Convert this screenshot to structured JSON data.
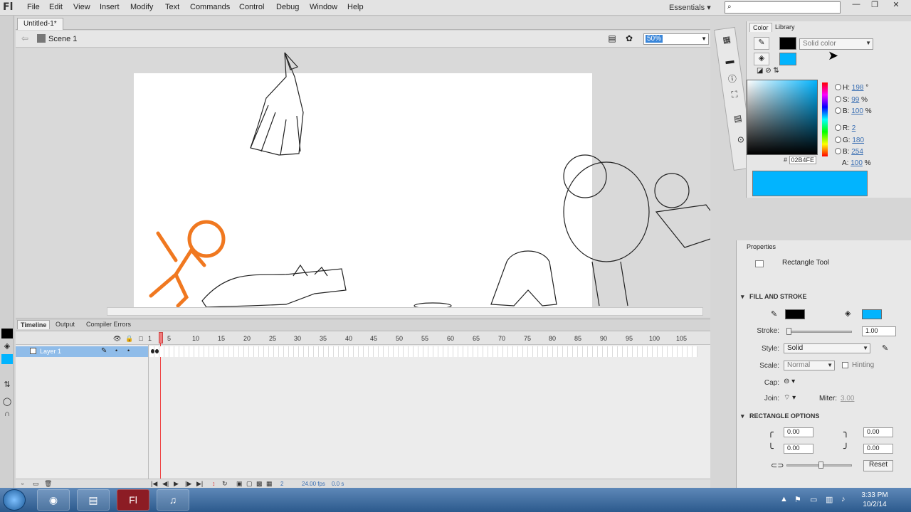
{
  "app": {
    "logo": "Fl"
  },
  "menu": [
    "File",
    "Edit",
    "View",
    "Insert",
    "Modify",
    "Text",
    "Commands",
    "Control",
    "Debug",
    "Window",
    "Help"
  ],
  "workspace": {
    "label": "Essentials",
    "arrow": "▾"
  },
  "window_controls": [
    "—",
    "❐",
    "✕"
  ],
  "document": {
    "tab": "Untitled-1*",
    "scene": "Scene 1",
    "zoom": "50%"
  },
  "timeline": {
    "tabs": [
      "Timeline",
      "Output",
      "Compiler Errors"
    ],
    "frame_numbers": [
      "1",
      "5",
      "10",
      "15",
      "20",
      "25",
      "30",
      "35",
      "40",
      "45",
      "50",
      "55",
      "60",
      "65",
      "70",
      "75",
      "80",
      "85",
      "90",
      "95",
      "100",
      "105"
    ],
    "layer_name": "Layer 1",
    "current_frame": "2",
    "fps": "24.00 fps",
    "time": "0.0 s"
  },
  "color_panel": {
    "tabs": [
      "Color",
      "Library"
    ],
    "fill_type": "Solid color",
    "stroke_color": "#000000",
    "fill_color": "#02B4FE",
    "H": "198",
    "S": "99",
    "B": "100",
    "R": "2",
    "G": "180",
    "Bv": "254",
    "A": "100",
    "labels": {
      "H": "H:",
      "S": "S:",
      "B": "B:",
      "R": "R:",
      "G": "G:",
      "Bl": "B:",
      "A": "A:"
    },
    "deg": "°",
    "pct": "%",
    "hex_label": "#",
    "hex": "02B4FE"
  },
  "properties": {
    "title": "Properties",
    "tool": "Rectangle Tool",
    "fill_stroke_header": "FILL AND STROKE",
    "stroke_label": "Stroke:",
    "stroke_value": "1.00",
    "style_label": "Style:",
    "style_value": "Solid",
    "scale_label": "Scale:",
    "scale_value": "Normal",
    "hinting": "Hinting",
    "cap_label": "Cap:",
    "join_label": "Join:",
    "miter_label": "Miter:",
    "miter_value": "3.00",
    "rect_header": "RECTANGLE OPTIONS",
    "corners": [
      "0.00",
      "0.00",
      "0.00",
      "0.00"
    ],
    "reset": "Reset"
  },
  "taskbar": {
    "time": "3:33 PM",
    "date": "10/2/14"
  }
}
